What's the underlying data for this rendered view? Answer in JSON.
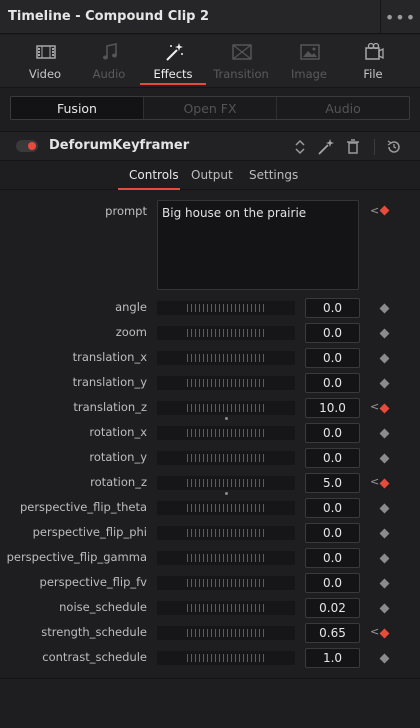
{
  "window": {
    "title": "Timeline - Compound Clip 2",
    "menu_glyph": "•••"
  },
  "inspector_tabs": [
    {
      "label": "Video",
      "icon": "film-icon",
      "state": "enabled"
    },
    {
      "label": "Audio",
      "icon": "music-note-icon",
      "state": "disabled"
    },
    {
      "label": "Effects",
      "icon": "magic-wand-icon",
      "state": "active"
    },
    {
      "label": "Transition",
      "icon": "transition-icon",
      "state": "disabled"
    },
    {
      "label": "Image",
      "icon": "image-icon",
      "state": "disabled"
    },
    {
      "label": "File",
      "icon": "file-icon",
      "state": "enabled"
    }
  ],
  "effect_category": {
    "options": [
      "Fusion",
      "Open FX",
      "Audio"
    ],
    "selected": "Fusion"
  },
  "effect": {
    "name": "DeforumKeyframer",
    "enabled": true
  },
  "sub_tabs": [
    "Controls",
    "Output",
    "Settings"
  ],
  "active_sub_tab": "Controls",
  "prompt": {
    "label": "prompt",
    "value": "Big house on the prairie",
    "keyframed": true
  },
  "params": [
    {
      "label": "angle",
      "value": "0.0",
      "keyframed": false,
      "slider_marker": false
    },
    {
      "label": "zoom",
      "value": "0.0",
      "keyframed": false,
      "slider_marker": false
    },
    {
      "label": "translation_x",
      "value": "0.0",
      "keyframed": false,
      "slider_marker": false
    },
    {
      "label": "translation_y",
      "value": "0.0",
      "keyframed": false,
      "slider_marker": false
    },
    {
      "label": "translation_z",
      "value": "10.0",
      "keyframed": true,
      "slider_marker": true
    },
    {
      "label": "rotation_x",
      "value": "0.0",
      "keyframed": false,
      "slider_marker": false
    },
    {
      "label": "rotation_y",
      "value": "0.0",
      "keyframed": false,
      "slider_marker": false
    },
    {
      "label": "rotation_z",
      "value": "5.0",
      "keyframed": true,
      "slider_marker": true
    },
    {
      "label": "perspective_flip_theta",
      "value": "0.0",
      "keyframed": false,
      "slider_marker": false
    },
    {
      "label": "perspective_flip_phi",
      "value": "0.0",
      "keyframed": false,
      "slider_marker": false
    },
    {
      "label": "perspective_flip_gamma",
      "value": "0.0",
      "keyframed": false,
      "slider_marker": false
    },
    {
      "label": "perspective_flip_fv",
      "value": "0.0",
      "keyframed": false,
      "slider_marker": false
    },
    {
      "label": "noise_schedule",
      "value": "0.02",
      "keyframed": false,
      "slider_marker": false
    },
    {
      "label": "strength_schedule",
      "value": "0.65",
      "keyframed": true,
      "slider_marker": false
    },
    {
      "label": "contrast_schedule",
      "value": "1.0",
      "keyframed": false,
      "slider_marker": false
    }
  ],
  "colors": {
    "accent": "#e64b3c",
    "background": "#1e1e20"
  }
}
